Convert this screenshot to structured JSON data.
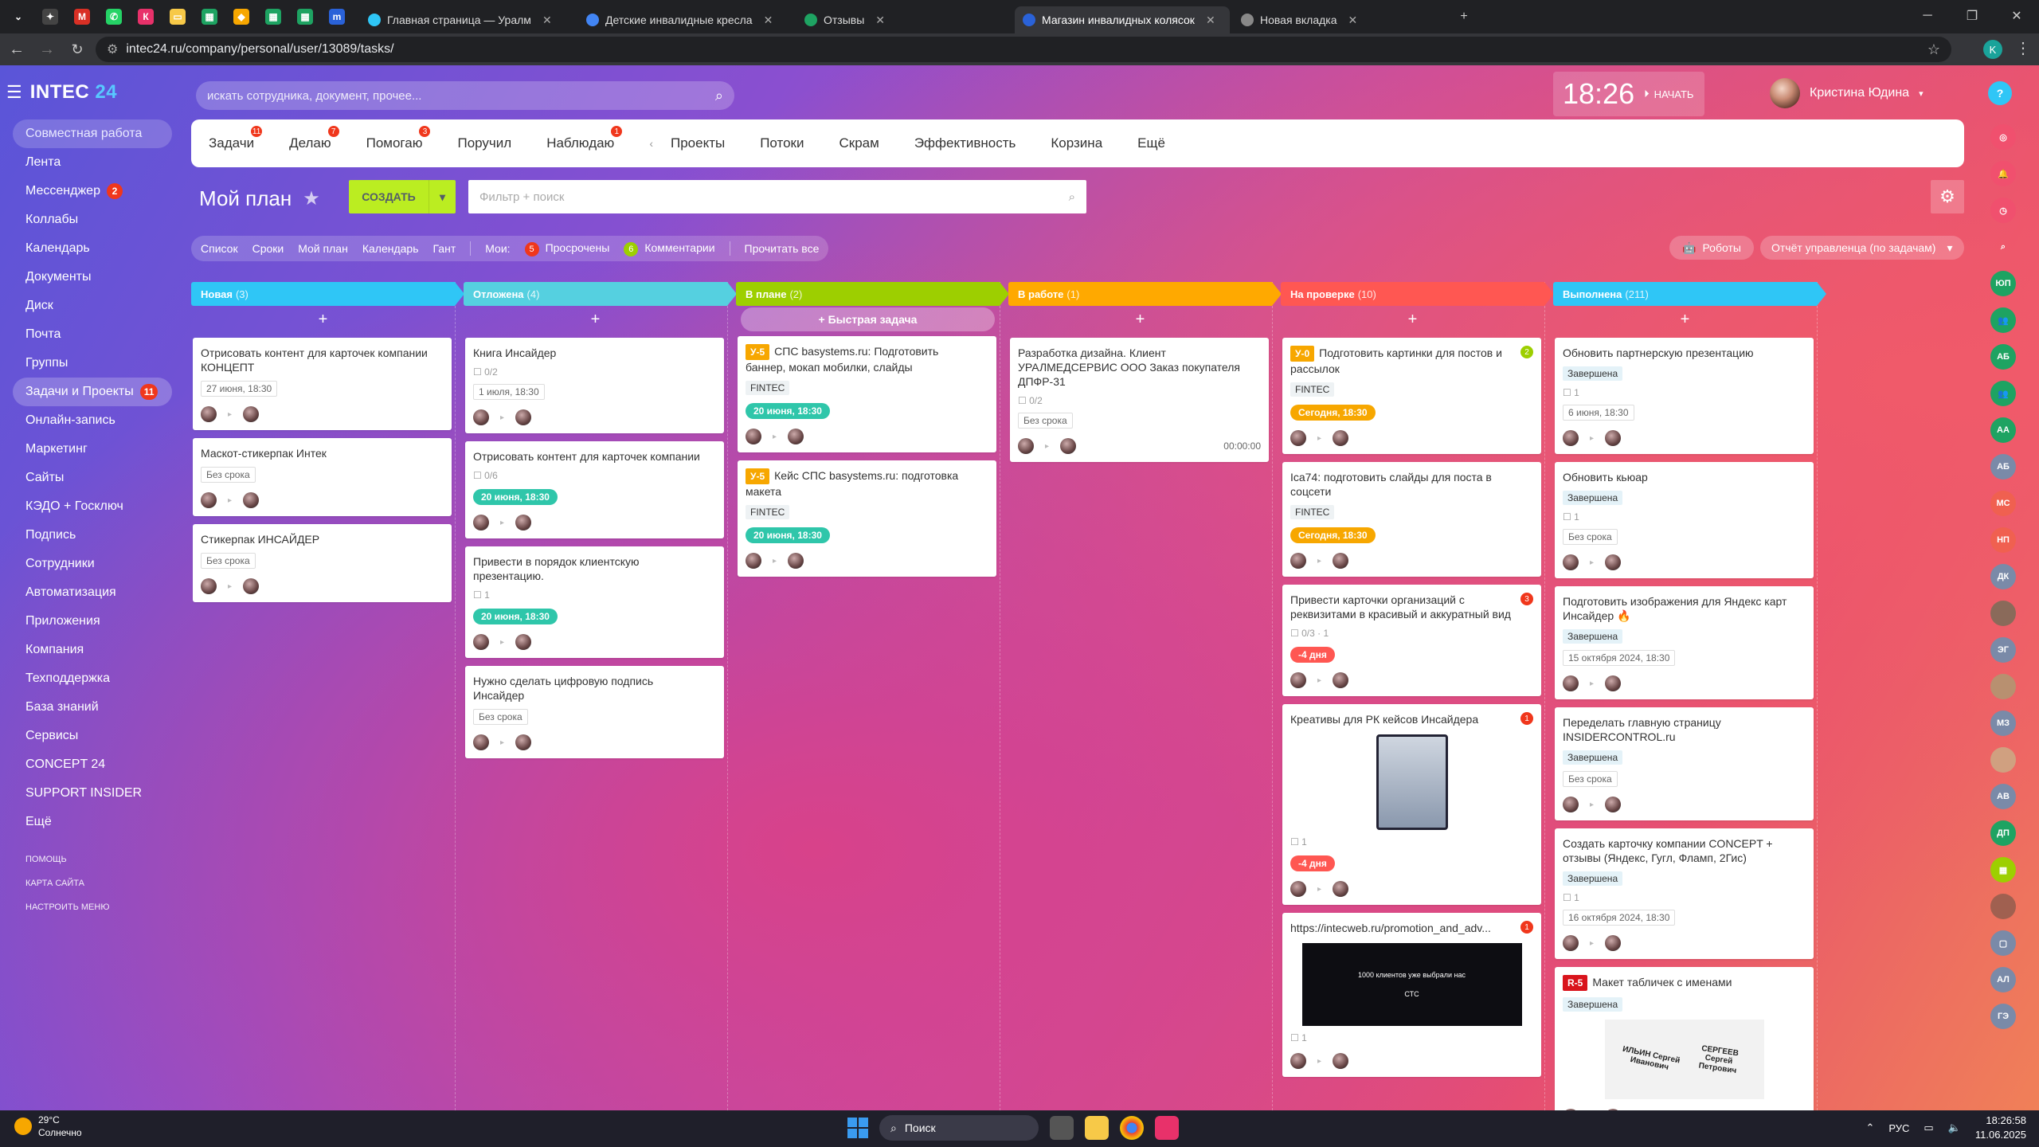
{
  "browser": {
    "pinned": [
      {
        "icon": "chevron-down-icon",
        "label": "⌄",
        "color": "#202124"
      },
      {
        "icon": "app-icon",
        "label": "✦",
        "color": "#444"
      },
      {
        "icon": "gmail-icon",
        "label": "M",
        "color": "#d93025"
      },
      {
        "icon": "whatsapp-icon",
        "label": "✆",
        "color": "#25d366"
      },
      {
        "icon": "app-pink-icon",
        "label": "К",
        "color": "#e8316a"
      },
      {
        "icon": "folder-icon",
        "label": "▭",
        "color": "#f7c948"
      },
      {
        "icon": "sheets-icon",
        "label": "▦",
        "color": "#1ea362"
      },
      {
        "icon": "bird-icon",
        "label": "◆",
        "color": "#f7a700"
      },
      {
        "icon": "sheets-icon",
        "label": "▦",
        "color": "#1ea362"
      },
      {
        "icon": "sheets-icon",
        "label": "▦",
        "color": "#1ea362"
      },
      {
        "icon": "app-blue-icon",
        "label": "m",
        "color": "#2a62d8"
      }
    ],
    "tabs": [
      {
        "title": "Главная страница — Уралм",
        "favicon": "#2fc6f6",
        "active": false
      },
      {
        "title": "Детские инвалидные кресла",
        "favicon": "#4285f4",
        "active": false
      },
      {
        "title": "Отзывы",
        "favicon": "#1ea362",
        "active": false
      },
      {
        "title": "Магазин инвалидных колясок",
        "favicon": "#2a62d8",
        "active": true
      },
      {
        "title": "Новая вкладка",
        "favicon": "#888",
        "active": false
      }
    ],
    "new_tab_label": "+",
    "url": "intec24.ru/company/personal/user/13089/tasks/",
    "profile_initial": "K"
  },
  "app": {
    "logo_main": "INTEC",
    "logo_num": "24",
    "search_placeholder": "искать сотрудника, документ, прочее...",
    "clock": "18:26",
    "start_label": "НАЧАТЬ",
    "user_name": "Кристина Юдина",
    "help": "?"
  },
  "leftmenu": [
    {
      "label": "Совместная работа",
      "type": "group",
      "count": ""
    },
    {
      "label": "Лента",
      "type": "item",
      "count": ""
    },
    {
      "label": "Мессенджер",
      "type": "item",
      "count": "2"
    },
    {
      "label": "Коллабы",
      "type": "item",
      "count": ""
    },
    {
      "label": "Календарь",
      "type": "item",
      "count": ""
    },
    {
      "label": "Документы",
      "type": "item",
      "count": ""
    },
    {
      "label": "Диск",
      "type": "item",
      "count": ""
    },
    {
      "label": "Почта",
      "type": "item",
      "count": ""
    },
    {
      "label": "Группы",
      "type": "item",
      "count": ""
    },
    {
      "label": "Задачи и Проекты",
      "type": "hl",
      "count": "11"
    },
    {
      "label": "Онлайн-запись",
      "type": "item",
      "count": ""
    },
    {
      "label": "Маркетинг",
      "type": "item",
      "count": ""
    },
    {
      "label": "Сайты",
      "type": "item",
      "count": ""
    },
    {
      "label": "КЭДО + Госключ",
      "type": "item",
      "count": ""
    },
    {
      "label": "Подпись",
      "type": "item",
      "count": ""
    },
    {
      "label": "Сотрудники",
      "type": "item",
      "count": ""
    },
    {
      "label": "Автоматизация",
      "type": "item",
      "count": ""
    },
    {
      "label": "Приложения",
      "type": "item",
      "count": ""
    },
    {
      "label": "Компания",
      "type": "item",
      "count": ""
    },
    {
      "label": "Техподдержка",
      "type": "item",
      "count": ""
    },
    {
      "label": "База знаний",
      "type": "item",
      "count": ""
    },
    {
      "label": "Сервисы",
      "type": "item",
      "count": ""
    },
    {
      "label": "CONCEPT 24",
      "type": "item",
      "count": ""
    },
    {
      "label": "SUPPORT INSIDER",
      "type": "item",
      "count": ""
    },
    {
      "label": "Ещё",
      "type": "item",
      "count": ""
    }
  ],
  "leftmenu_small": [
    "ПОМОЩЬ",
    "КАРТА САЙТА",
    "НАСТРОИТЬ МЕНЮ"
  ],
  "topnav": [
    {
      "label": "Задачи",
      "badge": "11"
    },
    {
      "label": "Делаю",
      "badge": "7"
    },
    {
      "label": "Помогаю",
      "badge": "3"
    },
    {
      "label": "Поручил",
      "badge": ""
    },
    {
      "label": "Наблюдаю",
      "badge": "1"
    },
    {
      "label": "Проекты",
      "badge": ""
    },
    {
      "label": "Потоки",
      "badge": ""
    },
    {
      "label": "Скрам",
      "badge": ""
    },
    {
      "label": "Эффективность",
      "badge": ""
    },
    {
      "label": "Корзина",
      "badge": ""
    },
    {
      "label": "Ещё",
      "badge": ""
    }
  ],
  "toolbar": {
    "title": "Мой план",
    "create": "СОЗДАТЬ",
    "filter_placeholder": "Фильтр + поиск",
    "views": [
      "Список",
      "Сроки",
      "Мой план",
      "Календарь",
      "Гант"
    ],
    "mine_label": "Мои:",
    "overdue_count": "5",
    "overdue_label": "Просрочены",
    "comments_count": "6",
    "comments_label": "Комментарии",
    "read_all": "Прочитать все",
    "robots": "Роботы",
    "report": "Отчёт управленца (по задачам)"
  },
  "columns": [
    {
      "title": "Новая",
      "count": "(3)",
      "color": "#2fc6f6",
      "quick": "",
      "cards": [
        {
          "title": "Отрисовать контент для карточек компании КОНЦЕПТ",
          "date": "27 июня, 18:30"
        },
        {
          "title": "Маскот-стикерпак Интек",
          "date": "Без срока"
        },
        {
          "title": "Стикерпак ИНСАЙДЕР",
          "date": "Без срока"
        }
      ]
    },
    {
      "title": "Отложена",
      "count": "(4)",
      "color": "#55d0e0",
      "quick": "",
      "cards": [
        {
          "title": "Книга Инсайдер",
          "meta": "0/2",
          "date": "1 июля, 18:30"
        },
        {
          "title": "Отрисовать контент для карточек компании",
          "meta": "0/6",
          "pill": "20 июня, 18:30"
        },
        {
          "title": "Привести в порядок клиентскую презентацию.",
          "meta": "1",
          "pill": "20 июня, 18:30"
        },
        {
          "title": "Нужно сделать цифровую подпись Инсайдер",
          "date": "Без срока"
        }
      ]
    },
    {
      "title": "В плане",
      "count": "(2)",
      "color": "#9dcf00",
      "quick": "+ Быстрая задача",
      "cards": [
        {
          "prefix": "У-5",
          "title": "СПС basystems.ru: Подготовить баннер, мокап мобилки, слайды",
          "tag": "FINTEC",
          "pill": "20 июня, 18:30"
        },
        {
          "prefix": "У-5",
          "title": "Кейс СПС basystems.ru: подготовка макета",
          "tag": "FINTEC",
          "pill": "20 июня, 18:30"
        }
      ]
    },
    {
      "title": "В работе",
      "count": "(1)",
      "color": "#ffa900",
      "quick": "",
      "cards": [
        {
          "title": "Разработка дизайна. Клиент УРАЛМЕДСЕРВИС ООО Заказ покупателя ДПФР-31",
          "meta": "0/2",
          "date": "Без срока",
          "right": "00:00:00"
        }
      ]
    },
    {
      "title": "На проверке",
      "count": "(10)",
      "color": "#ff5752",
      "quick": "",
      "cards": [
        {
          "prefix": "У-0",
          "title": "Подготовить картинки для постов и рассылок",
          "tag": "FINTEC",
          "pill_orange": "Сегодня, 18:30",
          "corner_g": "2"
        },
        {
          "title": "Ica74: подготовить слайды для поста в соцсети",
          "tag": "FINTEC",
          "pill_orange": "Сегодня, 18:30"
        },
        {
          "title": "Привести карточки организаций с реквизитами в красивый и аккуратный вид",
          "meta": "0/3 · 1",
          "pill_red": "-4 дня",
          "corner": "3"
        },
        {
          "title": "Креативы для РК кейсов Инсайдера",
          "image": "phone",
          "meta": "1",
          "pill_red": "-4 дня",
          "corner": "1"
        },
        {
          "title": "https://intecweb.ru/promotion_and_adv...",
          "image": "web",
          "web_caption": "1000 клиентов уже выбрали нас",
          "web_logo": "СТС",
          "meta": "1",
          "corner": "1"
        }
      ]
    },
    {
      "title": "Выполнена",
      "count": "(211)",
      "color": "#2fc6f6",
      "quick": "",
      "cards": [
        {
          "title": "Обновить партнерскую презентацию",
          "status": "Завершена",
          "meta": "1",
          "date": "6 июня, 18:30"
        },
        {
          "title": "Обновить кьюар",
          "status": "Завершена",
          "meta": "1",
          "date": "Без срока"
        },
        {
          "title": "Подготовить изображения для Яндекс карт Инсайдер 🔥",
          "status": "Завершена",
          "date": "15 октября 2024, 18:30"
        },
        {
          "title": "Переделать главную страницу INSIDERCONTROL.ru",
          "status": "Завершена",
          "date": "Без срока"
        },
        {
          "title": "Создать карточку компании CONCEPT + отзывы (Яндекс, Гугл, Фламп, 2Гис)",
          "status": "Завершена",
          "meta": "1",
          "date": "16 октября 2024, 18:30"
        },
        {
          "prefix": "R-5",
          "prefix_red": true,
          "title": "Макет табличек с именами",
          "status": "Завершена",
          "image": "signs",
          "sign1": "ИЛЬИН Сергей Иванович",
          "sign2": "СЕРГЕЕВ Сергей Петрович"
        }
      ]
    }
  ],
  "rail": [
    {
      "label": "◎",
      "color": "#f0506e"
    },
    {
      "label": "🔔",
      "color": "#f0506e"
    },
    {
      "label": "◷",
      "color": "#f0506e"
    },
    {
      "label": "⌕",
      "color": "rgba(255,255,255,0.0)"
    },
    {
      "label": "ЮП",
      "color": "#1ea362"
    },
    {
      "label": "👥",
      "color": "#1ea362"
    },
    {
      "label": "АБ",
      "color": "#1ea362"
    },
    {
      "label": "👥",
      "color": "#1ea362"
    },
    {
      "label": "АА",
      "color": "#1ea362"
    },
    {
      "label": "АБ",
      "color": "#7a8aa8"
    },
    {
      "label": "МС",
      "color": "#f06050"
    },
    {
      "label": "НП",
      "color": "#f06050"
    },
    {
      "label": "ДК",
      "color": "#7a8aa8"
    },
    {
      "label": "",
      "color": "#8a6a5a"
    },
    {
      "label": "ЭГ",
      "color": "#7a8aa8"
    },
    {
      "label": "",
      "color": "#b89070"
    },
    {
      "label": "МЗ",
      "color": "#7a8aa8"
    },
    {
      "label": "",
      "color": "#d0a080"
    },
    {
      "label": "АВ",
      "color": "#7a8aa8"
    },
    {
      "label": "ДП",
      "color": "#1ea362"
    },
    {
      "label": "▦",
      "color": "#9dcf00"
    },
    {
      "label": "",
      "color": "#a06050"
    },
    {
      "label": "▢",
      "color": "#7a8aa8"
    },
    {
      "label": "АЛ",
      "color": "#7a8aa8"
    },
    {
      "label": "ГЭ",
      "color": "#7a8aa8"
    }
  ],
  "taskbar": {
    "temp": "29°C",
    "weather": "Солнечно",
    "search": "Поиск",
    "lang": "РУС",
    "time": "18:26:58",
    "date": "11.06.2025"
  }
}
